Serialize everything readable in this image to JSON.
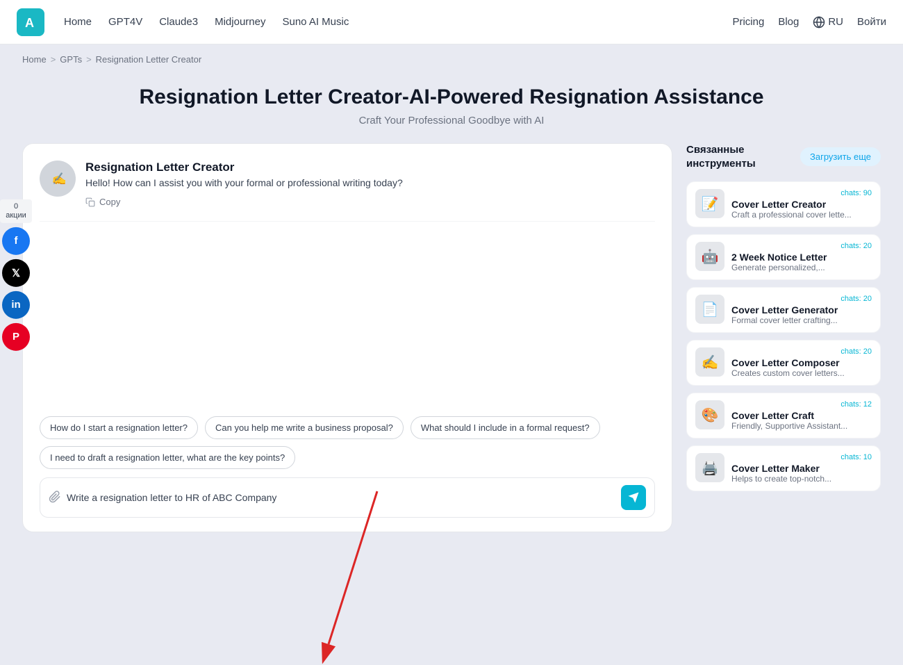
{
  "navbar": {
    "logo_alt": "AI Logo",
    "links": [
      {
        "label": "Home",
        "href": "#"
      },
      {
        "label": "GPT4V",
        "href": "#"
      },
      {
        "label": "Claude3",
        "href": "#"
      },
      {
        "label": "Midjourney",
        "href": "#"
      },
      {
        "label": "Suno AI Music",
        "href": "#"
      }
    ],
    "right_links": [
      {
        "label": "Pricing",
        "href": "#"
      },
      {
        "label": "Blog",
        "href": "#"
      }
    ],
    "lang_label": "RU",
    "login_label": "Войти"
  },
  "breadcrumb": {
    "home": "Home",
    "gpts": "GPTs",
    "current": "Resignation Letter Creator"
  },
  "page": {
    "title": "Resignation Letter Creator-AI-Powered Resignation Assistance",
    "subtitle": "Craft Your Professional Goodbye with AI"
  },
  "chat": {
    "bot_name": "Resignation Letter Creator",
    "greeting": "Hello! How can I assist you with your formal or professional writing today?",
    "copy_label": "Copy",
    "input_placeholder": "Write a resignation letter to HR of ABC Company",
    "suggestions": [
      "How do I start a resignation letter?",
      "Can you help me write a business proposal?",
      "What should I include in a formal request?",
      "I need to draft a resignation letter, what are the key points?"
    ]
  },
  "sidebar": {
    "title": "Связанные инструменты",
    "load_more": "Загрузить еще",
    "items": [
      {
        "name": "Cover Letter Creator",
        "desc": "Craft a professional cover lette...",
        "chats": "chats: 90",
        "emoji": "📝"
      },
      {
        "name": "2 Week Notice Letter",
        "desc": "Generate personalized,...",
        "chats": "chats: 20",
        "emoji": "🤖"
      },
      {
        "name": "Cover Letter Generator",
        "desc": "Formal cover letter crafting...",
        "chats": "chats: 20",
        "emoji": "📄"
      },
      {
        "name": "Cover Letter Composer",
        "desc": "Creates custom cover letters...",
        "chats": "chats: 20",
        "emoji": "✍️"
      },
      {
        "name": "Cover Letter Craft",
        "desc": "Friendly, Supportive Assistant...",
        "chats": "chats: 12",
        "emoji": "🎨"
      },
      {
        "name": "Cover Letter Maker",
        "desc": "Helps to create top-notch...",
        "chats": "chats: 10",
        "emoji": "🖨️"
      }
    ]
  },
  "social": {
    "count": "0",
    "count_label": "акции",
    "facebook": "f",
    "twitter": "𝕏",
    "linkedin": "in",
    "pinterest": "P"
  }
}
